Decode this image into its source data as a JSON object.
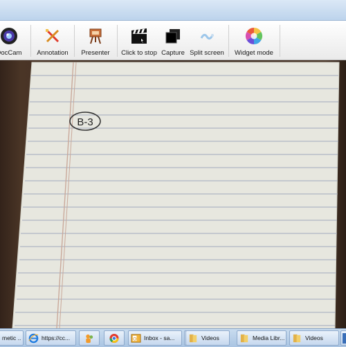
{
  "toolbar": {
    "items": [
      {
        "label": "DocCam",
        "icon": "webcam-icon"
      },
      {
        "label": "Annotation",
        "icon": "pencil-icon"
      },
      {
        "label": "Presenter",
        "icon": "presenter-easel-icon"
      },
      {
        "label": "Click to stop",
        "icon": "clapperboard-icon"
      },
      {
        "label": "Capture",
        "icon": "capture-icon"
      },
      {
        "label": "Split screen",
        "icon": "split-screen-icon"
      },
      {
        "label": "Widget mode",
        "icon": "color-wheel-icon"
      }
    ]
  },
  "camera": {
    "handwritten_label": "B-3"
  },
  "taskbar": {
    "items": [
      {
        "label": "metic ...",
        "icon": "app-icon"
      },
      {
        "label": "https://cc...",
        "icon": "ie-browser-icon"
      },
      {
        "label": "",
        "icon": "messenger-icon"
      },
      {
        "label": "",
        "icon": "chrome-icon"
      },
      {
        "label": "Inbox - sa...",
        "icon": "outlook-icon"
      },
      {
        "label": "",
        "icon": "folder-icon"
      },
      {
        "label": "Videos",
        "icon": "folder-icon"
      },
      {
        "label": "Media Libr...",
        "icon": "folder-icon"
      },
      {
        "label": "Videos",
        "icon": "folder-icon"
      },
      {
        "label": "",
        "icon": "app-icon"
      }
    ]
  },
  "colors": {
    "titlebar": "#c6dbf0",
    "toolbar": "#f2f2f2",
    "desk": "#3b2a1e",
    "paper": "#e9e9e1",
    "margin_line": "#c9a89a",
    "rule_line": "#9aa3b5",
    "taskbar": "#b8cfe8"
  }
}
